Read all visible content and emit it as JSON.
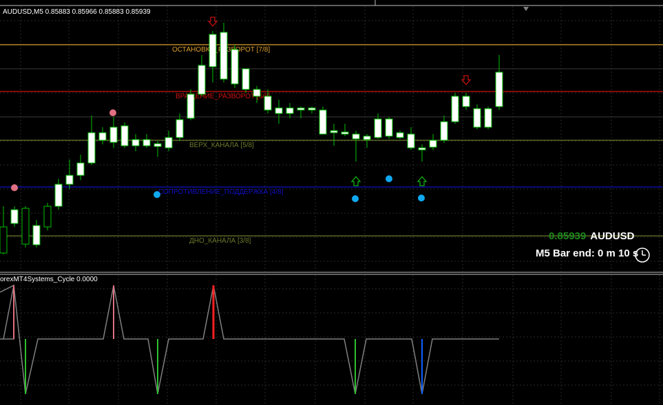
{
  "window": {
    "symbol_info": "AUDUSD,M5  0.85883 0.85966 0.85883 0.85939"
  },
  "levels": [
    {
      "label": "ОСТАНОВКА_РАЗВОРОТ [7/8]",
      "color": "#e0a030",
      "price_key": "7/8"
    },
    {
      "label": "ВРАЩЕНИЕ_РАЗВОРОТ [6/8]",
      "color": "#d01010",
      "price_key": "6/8"
    },
    {
      "label": "ВЕРХ_КАНАЛА [5/8]",
      "color": "#6a7a2a",
      "price_key": "5/8"
    },
    {
      "label": "СОПРОТИВЛЕНИЕ_ПОДДЕРЖКА [4/8]",
      "color": "#1010c8",
      "price_key": "4/8"
    },
    {
      "label": "ДНО_КАНАЛА [3/8]",
      "color": "#6a7a2a",
      "price_key": "3/8"
    }
  ],
  "price_panel": {
    "price": "0.85939",
    "symbol": "AUDUSD",
    "bar_end": "M5 Bar end: 0 m 10 s",
    "price_color": "#1e8a1e"
  },
  "indicator": {
    "label": "orexMT4Systems_Cycle 0.0000"
  },
  "colors": {
    "background": "#000000",
    "grid": "#2a2a2a",
    "bull_candle": "#ffffff",
    "candle_outline": "#00c000",
    "arrow_down": "#c01010",
    "arrow_up": "#10b010",
    "dot_pink": "#e07080",
    "dot_blue": "#10a8f0",
    "cycle_line": "#808080",
    "cycle_pink": "#e07080",
    "cycle_red": "#ff2020",
    "cycle_green": "#30c030",
    "cycle_blue": "#1060ff"
  },
  "icons": [
    "down-arrow-icon",
    "up-arrow-icon",
    "clock-icon"
  ]
}
